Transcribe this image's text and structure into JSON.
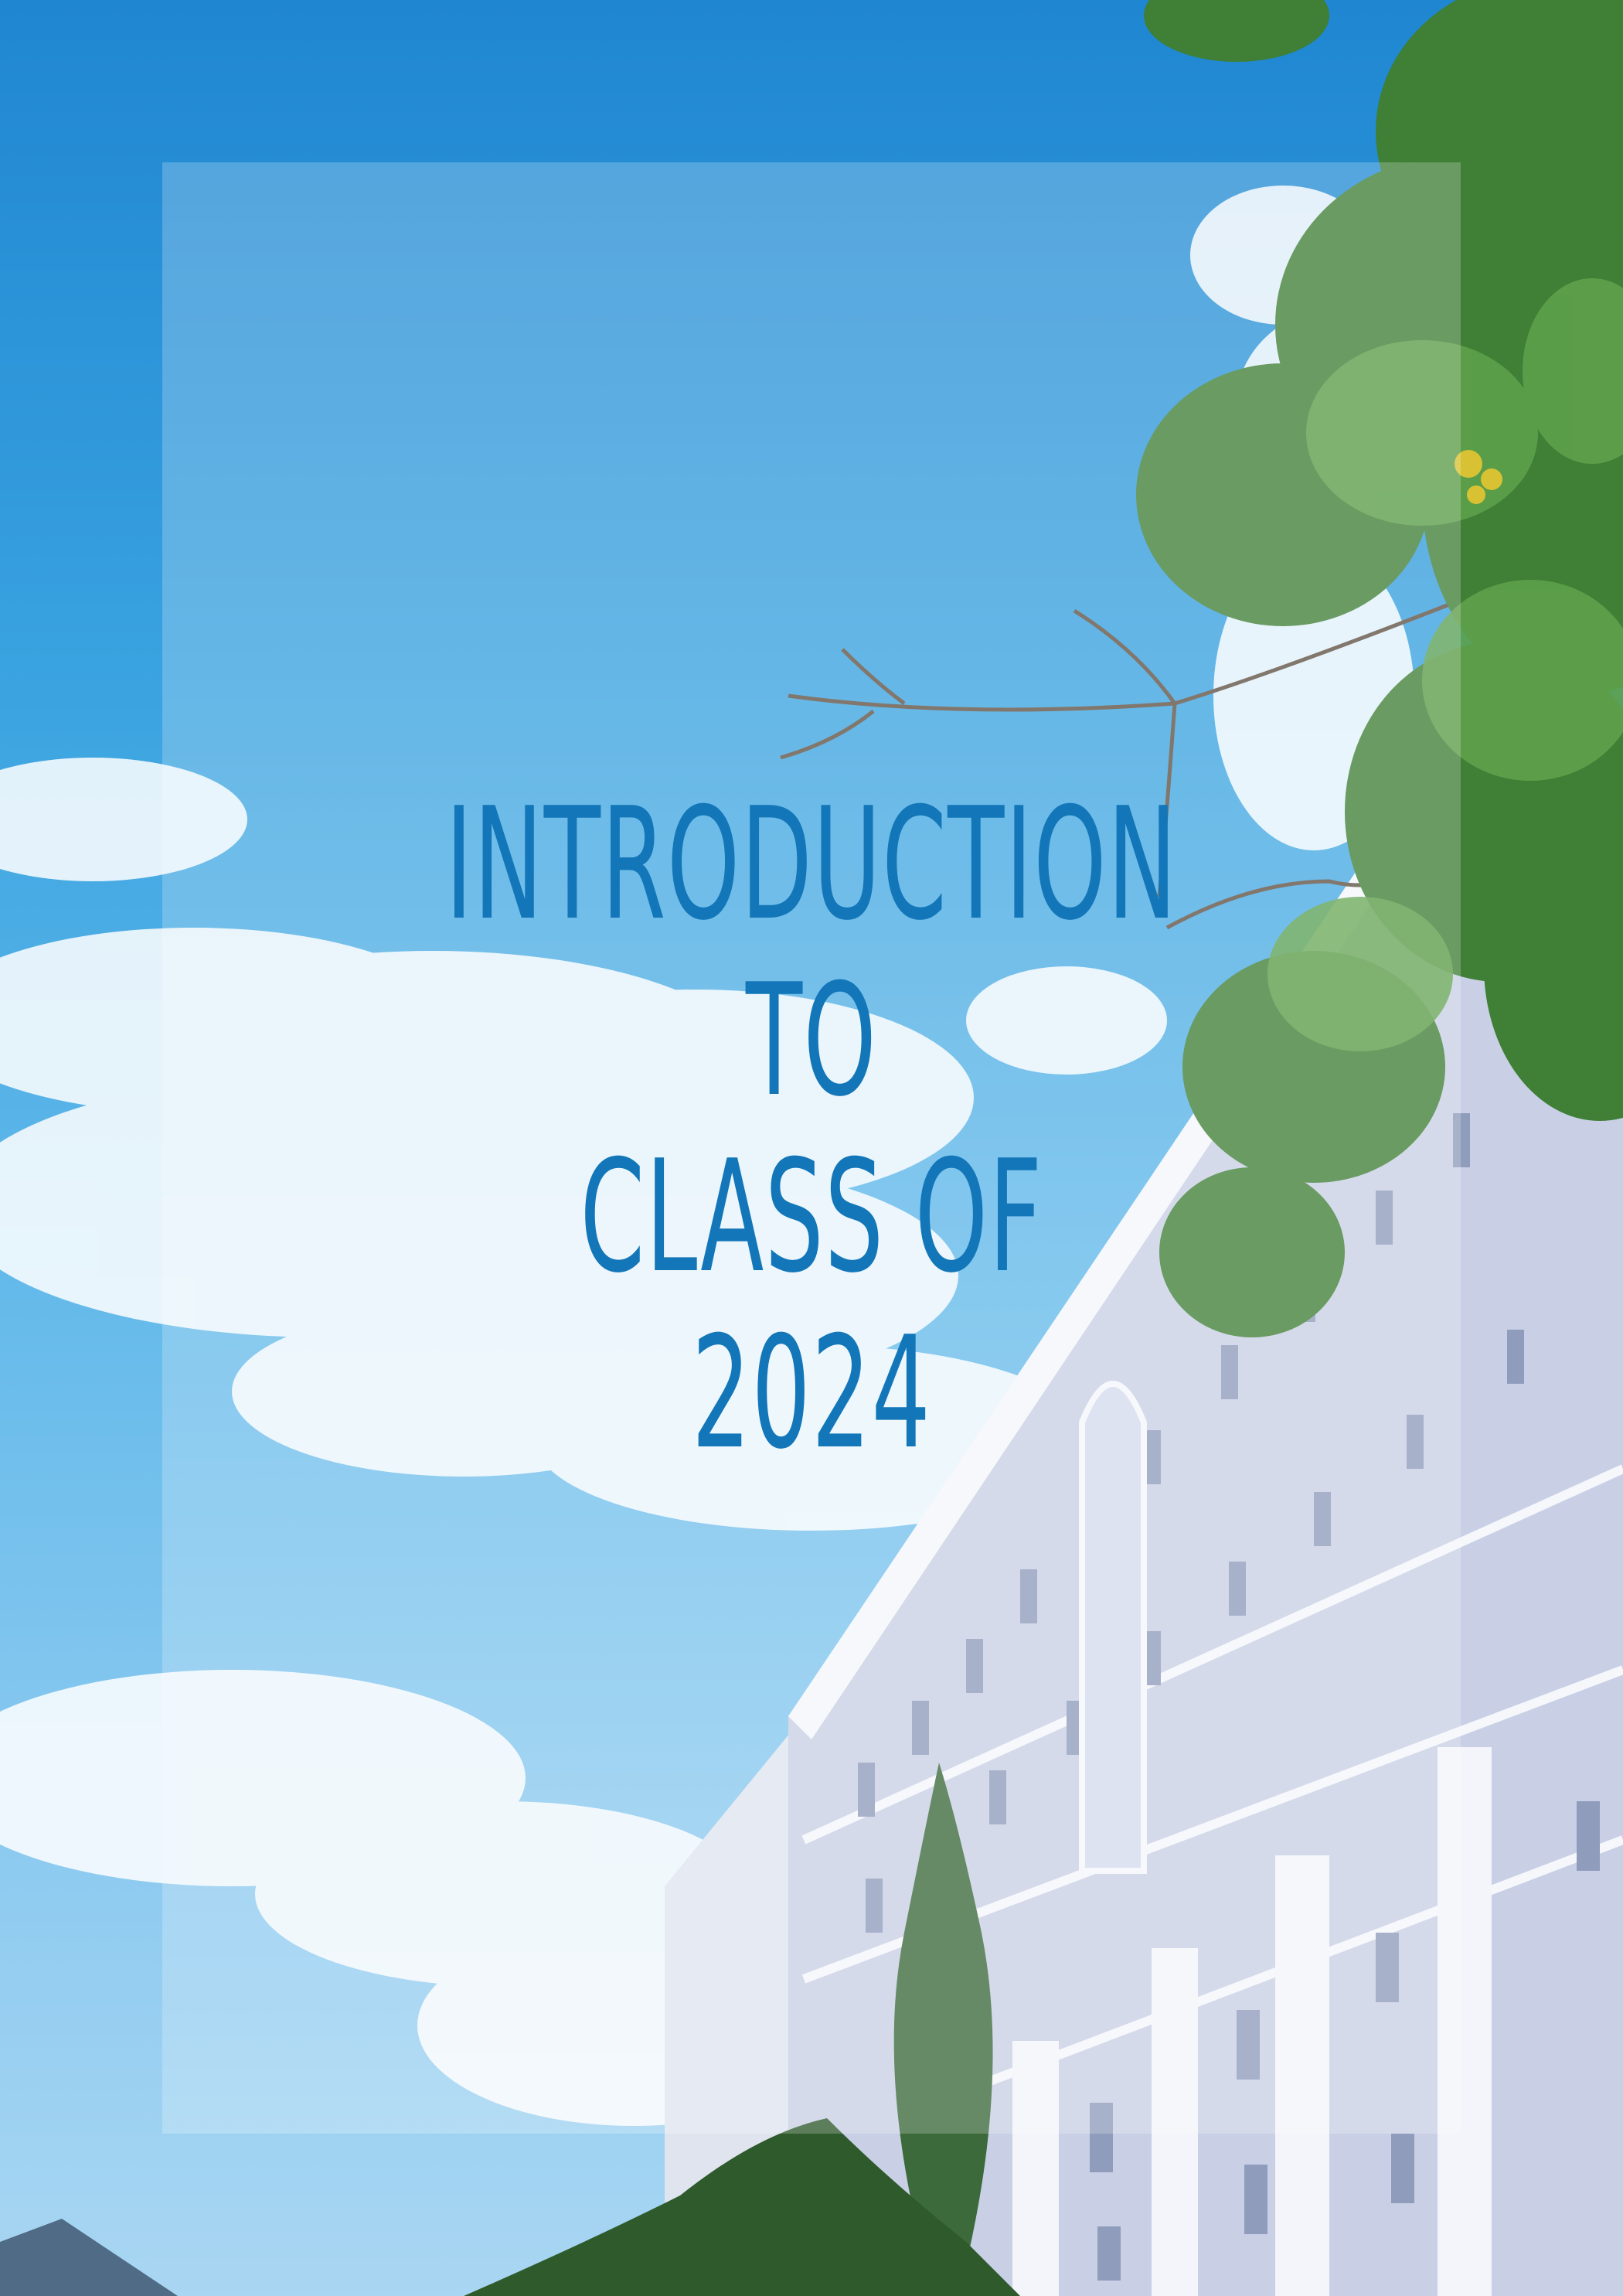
{
  "cover": {
    "title_lines": [
      "INTRODUCTION",
      "TO",
      "CLASS OF",
      "2024"
    ]
  },
  "colors": {
    "title": "#1276b8",
    "sky_top": "#1f86d1",
    "sky_bottom": "#a9d6f2",
    "overlay": "rgba(255,255,255,0.22)"
  },
  "icons": {
    "background": "photo-building-sky-trees"
  }
}
